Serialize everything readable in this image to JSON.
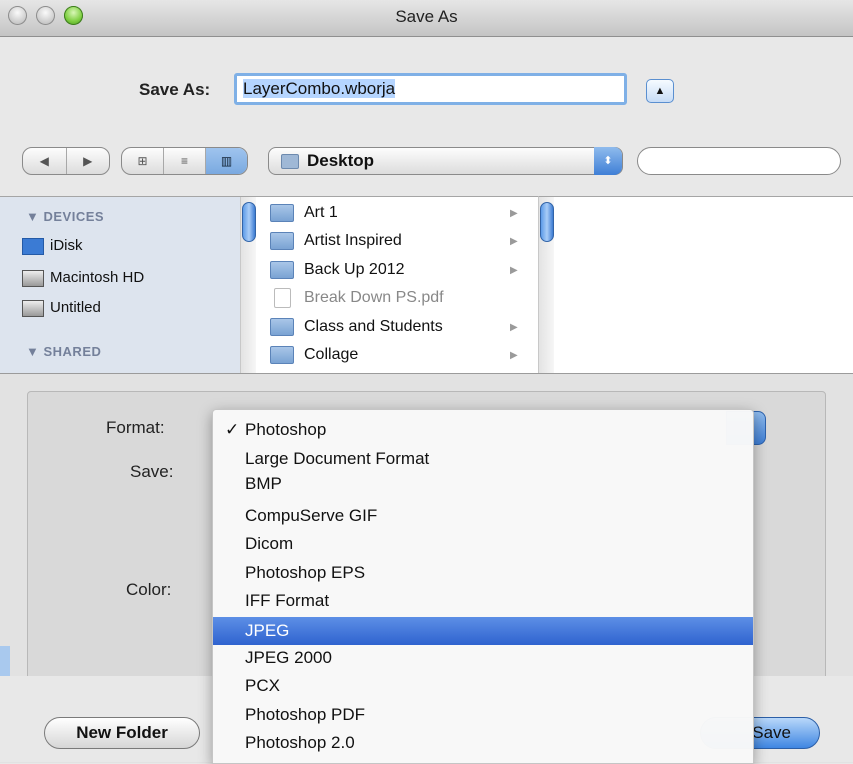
{
  "window": {
    "title": "Save As"
  },
  "save_as": {
    "label": "Save As:",
    "filename": "LayerCombo.wborja",
    "expand_glyph": "▲"
  },
  "toolbar": {
    "back_glyph": "◀",
    "forward_glyph": "▶",
    "view_icons": [
      "⊞",
      "≡",
      "▥"
    ],
    "location": "Desktop",
    "stepper_glyph": "⬍",
    "search_value": "",
    "search_glyph": "⚲"
  },
  "sidebar": {
    "devices_header": "▼ DEVICES",
    "devices": [
      {
        "label": "iDisk",
        "icon": "idisk-icon"
      },
      {
        "label": "Macintosh HD",
        "icon": "hard-drive-icon"
      },
      {
        "label": "Untitled",
        "icon": "hard-drive-icon"
      }
    ],
    "shared_header": "▼ SHARED"
  },
  "files": [
    {
      "label": "Art 1",
      "kind": "folder",
      "has_children": true
    },
    {
      "label": "Artist Inspired",
      "kind": "folder",
      "has_children": true
    },
    {
      "label": "Back Up 2012",
      "kind": "folder",
      "has_children": true
    },
    {
      "label": "Break Down PS.pdf",
      "kind": "pdf",
      "has_children": false
    },
    {
      "label": "Class and Students",
      "kind": "folder",
      "has_children": true
    },
    {
      "label": "Collage",
      "kind": "folder",
      "has_children": true
    }
  ],
  "options": {
    "format_label": "Format:",
    "save_label": "Save:",
    "color_label": "Color:"
  },
  "format_menu": {
    "checkmark": "✓",
    "items": [
      "Photoshop",
      "Large Document Format",
      "BMP",
      "CompuServe GIF",
      "Dicom",
      "Photoshop EPS",
      "IFF Format",
      "JPEG",
      "JPEG 2000",
      "PCX",
      "Photoshop PDF",
      "Photoshop 2.0"
    ],
    "checked": "Photoshop",
    "highlighted": "JPEG"
  },
  "buttons": {
    "new_folder": "New Folder",
    "save": "Save"
  }
}
